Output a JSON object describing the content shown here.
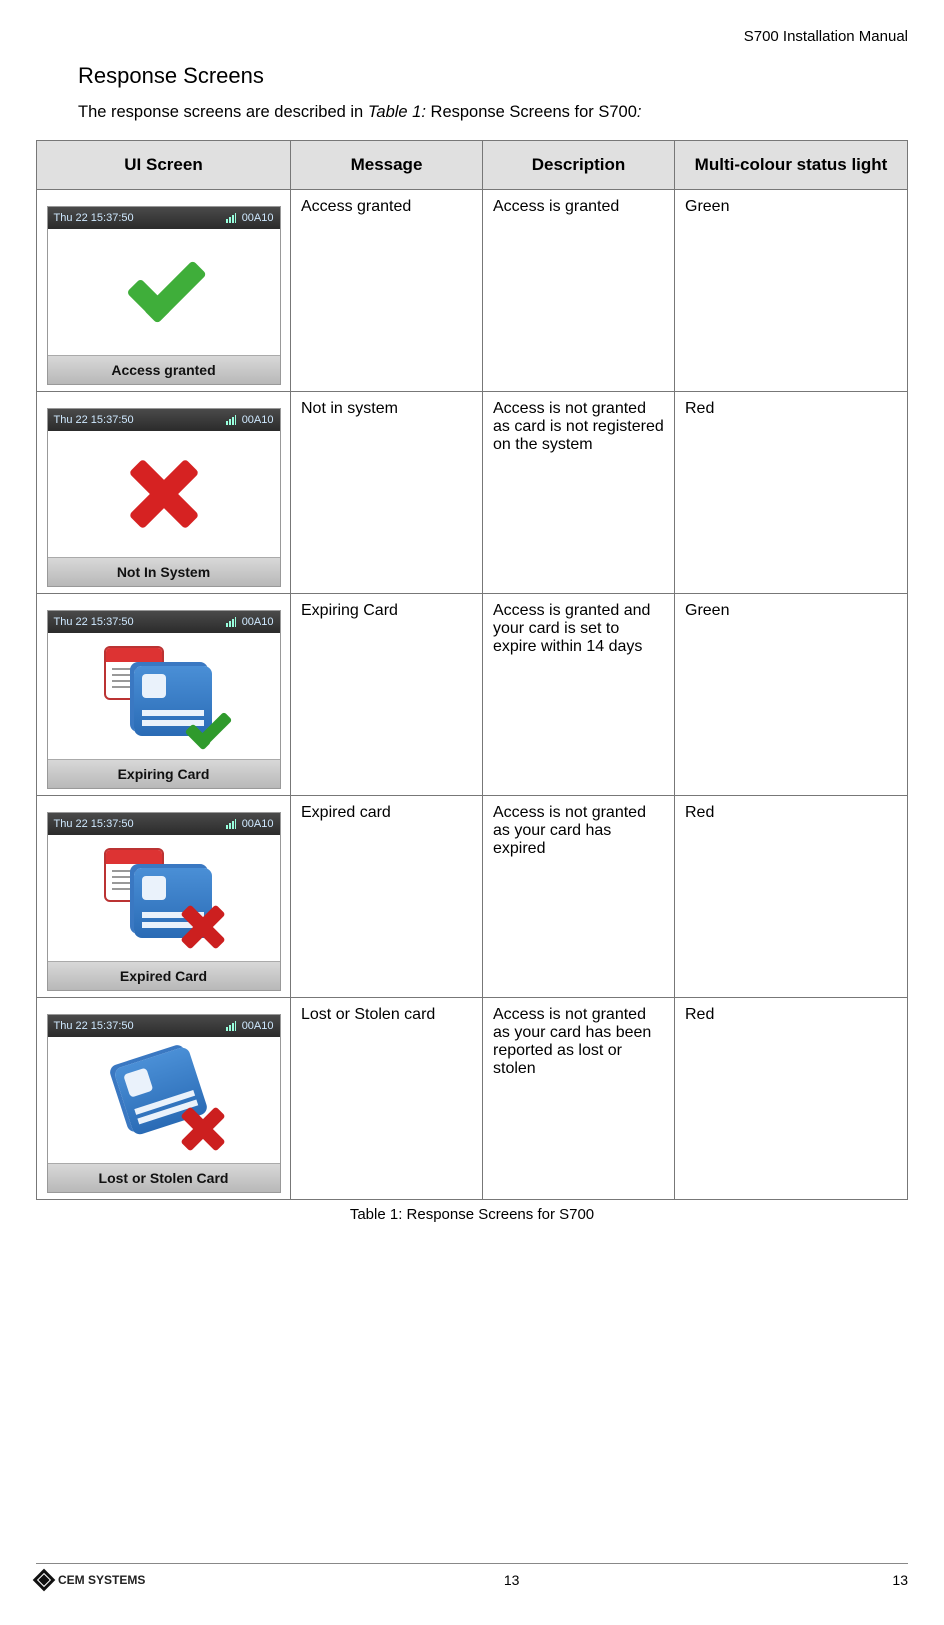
{
  "header": {
    "doc_title": "S700 Installation Manual"
  },
  "section": {
    "title": "Response Screens",
    "intro_plain": "The response screens are described in ",
    "intro_ref": "Table 1:",
    "intro_tail": " Response Screens for S700",
    "intro_colon": ":"
  },
  "table": {
    "headers": {
      "ui": "UI Screen",
      "msg": "Message",
      "desc": "Description",
      "light": "Multi-colour status light"
    },
    "rows": [
      {
        "ui": {
          "time": "Thu 22 15:37:50",
          "code": "00A10",
          "footer": "Access granted",
          "icon": "check"
        },
        "message": "Access granted",
        "description": "Access is granted",
        "light": "Green"
      },
      {
        "ui": {
          "time": "Thu 22 15:37:50",
          "code": "00A10",
          "footer": "Not In System",
          "icon": "redx"
        },
        "message": "Not in system",
        "description": "Access is not granted as card is not registered on the system",
        "light": "Red"
      },
      {
        "ui": {
          "time": "Thu 22 15:37:50",
          "code": "00A10",
          "footer": "Expiring Card",
          "icon": "cardcheck"
        },
        "message": "Expiring Card",
        "description": "Access is granted and your card is set to expire within 14 days",
        "light": "Green"
      },
      {
        "ui": {
          "time": "Thu 22 15:37:50",
          "code": "00A10",
          "footer": "Expired Card",
          "icon": "cardx"
        },
        "message": "Expired card",
        "description": "Access is not granted as your card has expired",
        "light": "Red"
      },
      {
        "ui": {
          "time": "Thu 22 15:37:50",
          "code": "00A10",
          "footer": "Lost or Stolen Card",
          "icon": "lost"
        },
        "message": "Lost or Stolen card",
        "description": "Access is not granted as your card has been reported as lost or stolen",
        "light": "Red"
      }
    ],
    "caption": "Table 1: Response Screens for S700"
  },
  "footer": {
    "brand": "CEM SYSTEMS",
    "page_center": "13",
    "page_edge": "13"
  }
}
